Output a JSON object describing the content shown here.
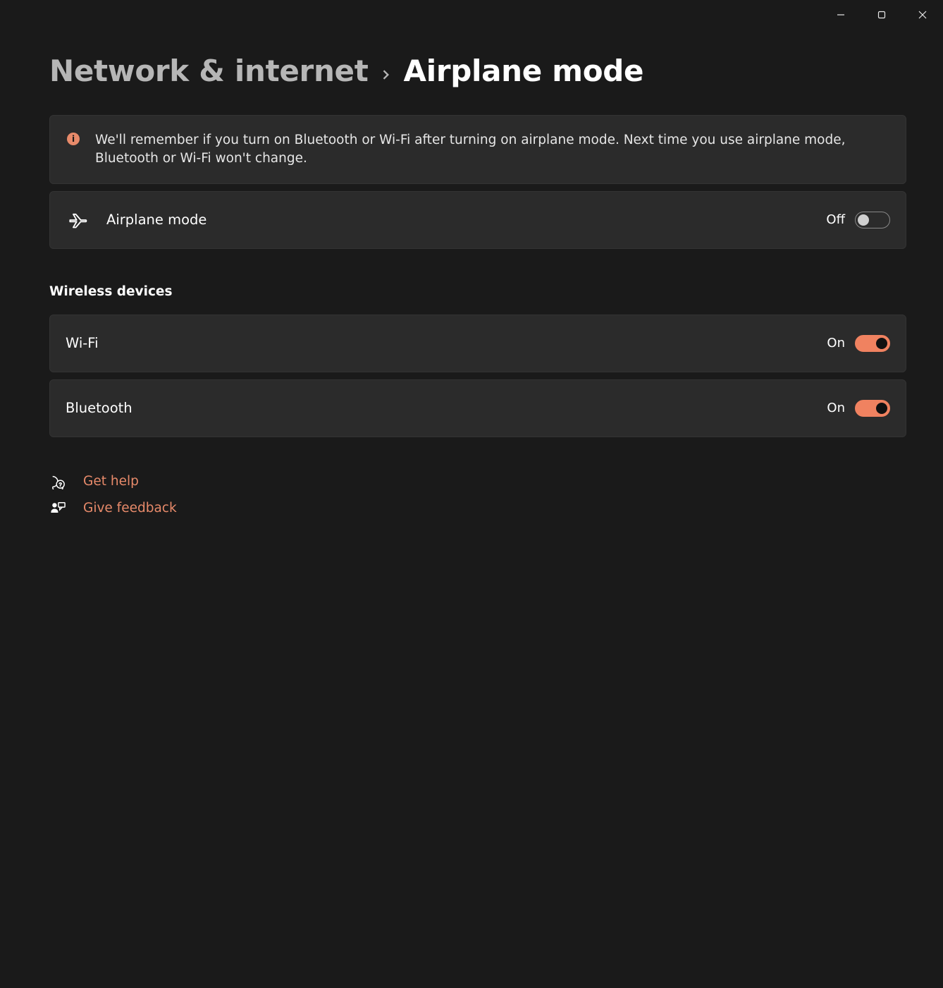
{
  "breadcrumb": {
    "parent": "Network & internet",
    "current": "Airplane mode"
  },
  "info_banner": "We'll remember if you turn on Bluetooth or Wi-Fi after turning on airplane mode. Next time you use airplane mode, Bluetooth or Wi-Fi won't change.",
  "airplane": {
    "label": "Airplane mode",
    "state": "Off"
  },
  "section_wireless": "Wireless devices",
  "wifi": {
    "label": "Wi-Fi",
    "state": "On"
  },
  "bluetooth": {
    "label": "Bluetooth",
    "state": "On"
  },
  "help_link": "Get help",
  "feedback_link": "Give feedback"
}
